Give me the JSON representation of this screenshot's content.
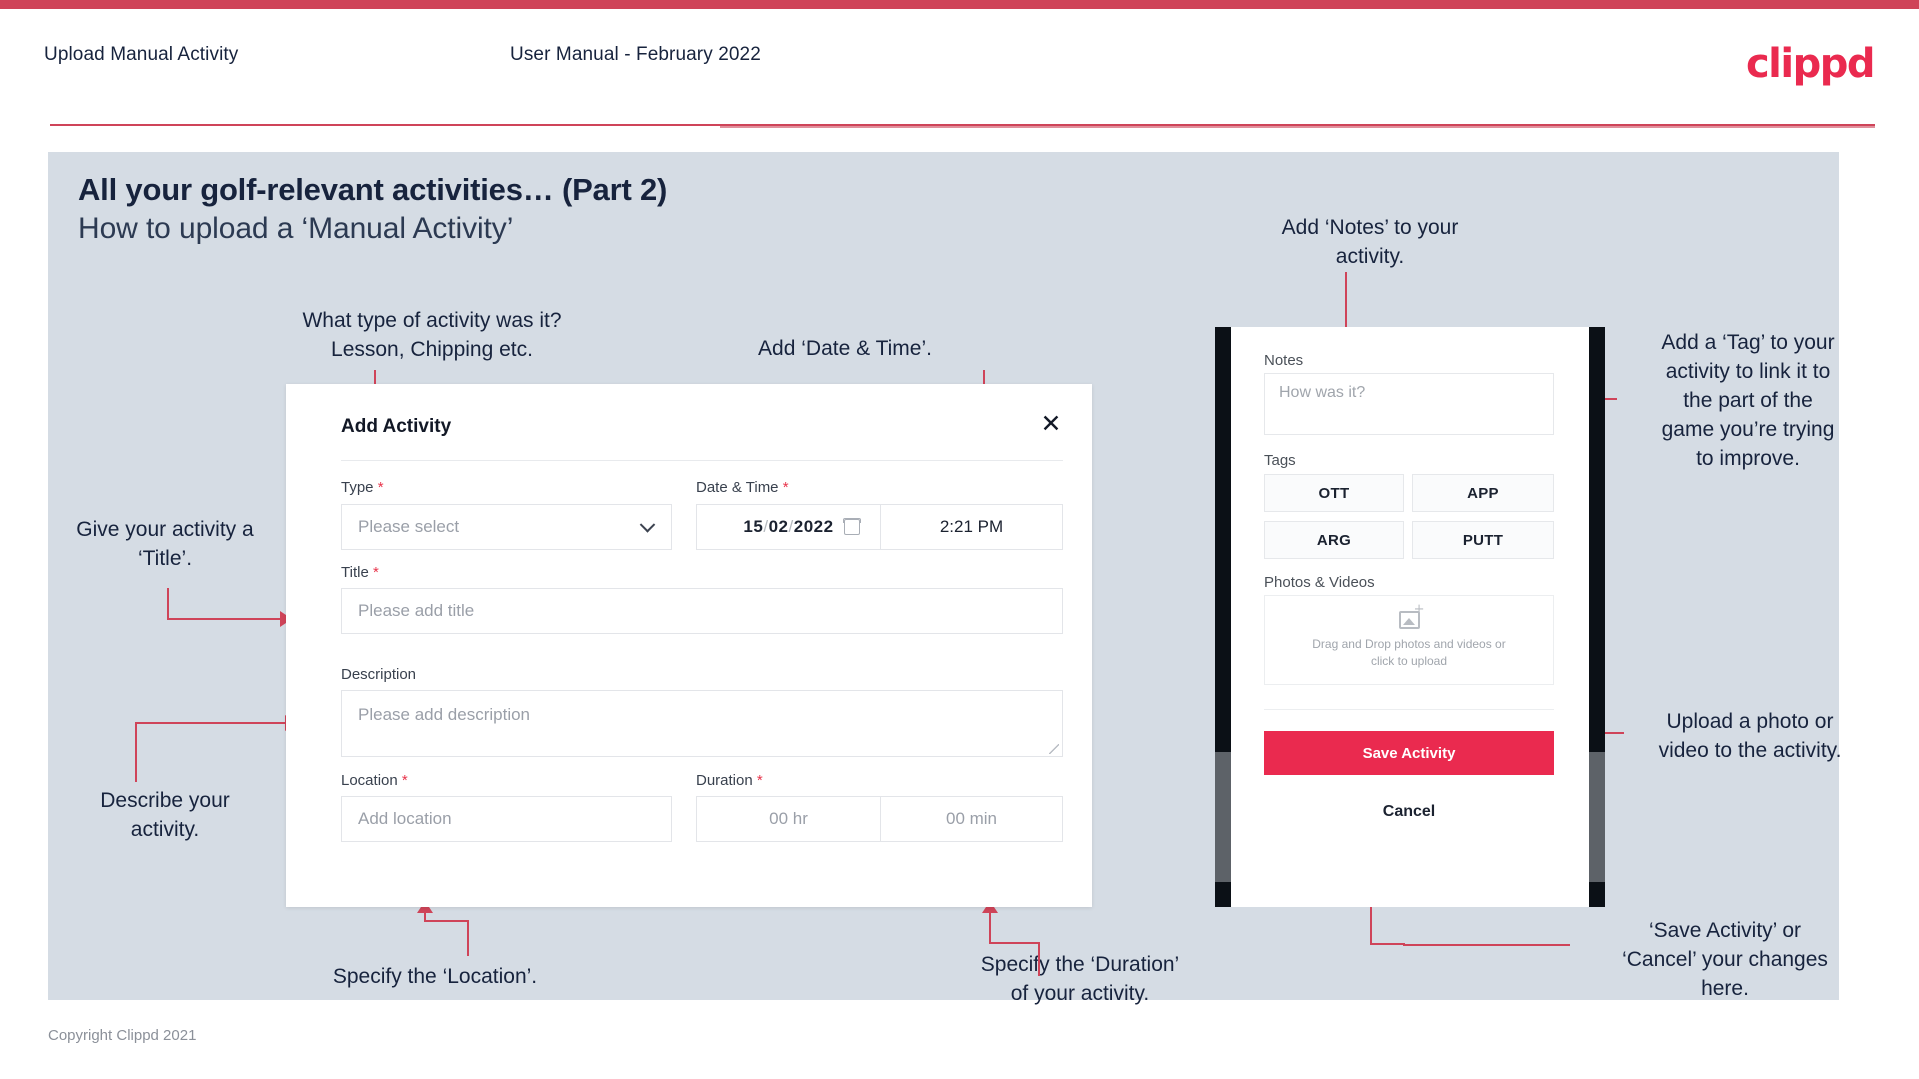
{
  "header": {
    "title": "Upload Manual Activity",
    "subtitle": "User Manual - February 2022",
    "logo": "clippd",
    "brand_color": "#ea2a4f",
    "rule_color": "#cf4459"
  },
  "slide": {
    "heading": "All your golf-relevant activities… (Part 2)",
    "subheading": "How to upload a ‘Manual Activity’",
    "background": "#d5dce4"
  },
  "annotations": {
    "type": "What type of activity was it?\nLesson, Chipping etc.",
    "datetime": "Add ‘Date & Time’.",
    "notes": "Add ‘Notes’ to your\nactivity.",
    "tag": "Add a ‘Tag’ to your\nactivity to link it to\nthe part of the\ngame you’re trying\nto improve.",
    "title": "Give your activity a\n‘Title’.",
    "describe": "Describe your\nactivity.",
    "location": "Specify the ‘Location’.",
    "duration": "Specify the ‘Duration’\nof your activity.",
    "upload": "Upload a photo or\nvideo to the activity.",
    "save_cancel": "‘Save Activity’ or\n‘Cancel’ your changes\nhere."
  },
  "dialog": {
    "title": "Add Activity",
    "close_icon": "close-icon",
    "fields": {
      "type": {
        "label": "Type",
        "required": "*",
        "placeholder": "Please select",
        "icon": "chevron-down-icon"
      },
      "datetime": {
        "label": "Date & Time",
        "required": "*",
        "day": "15",
        "month": "02",
        "year": "2022",
        "sep": "/",
        "time": "2:21 PM",
        "icon": "calendar-icon"
      },
      "title": {
        "label": "Title",
        "required": "*",
        "placeholder": "Please add title"
      },
      "description": {
        "label": "Description",
        "required": "",
        "placeholder": "Please add description"
      },
      "location": {
        "label": "Location",
        "required": "*",
        "placeholder": "Add location"
      },
      "duration": {
        "label": "Duration",
        "required": "*",
        "hours_placeholder": "00 hr",
        "minutes_placeholder": "00 min"
      }
    }
  },
  "phone": {
    "notes": {
      "label": "Notes",
      "placeholder": "How was it?"
    },
    "tags": {
      "label": "Tags",
      "items": [
        "OTT",
        "APP",
        "ARG",
        "PUTT"
      ]
    },
    "photos": {
      "label": "Photos & Videos",
      "dropzone_line1": "Drag and Drop photos and videos or",
      "dropzone_line2": "click to upload",
      "icon": "add-image-icon"
    },
    "save_label": "Save Activity",
    "cancel_label": "Cancel",
    "save_color": "#ea2a4f"
  },
  "footer": {
    "copyright": "Copyright Clippd 2021"
  }
}
